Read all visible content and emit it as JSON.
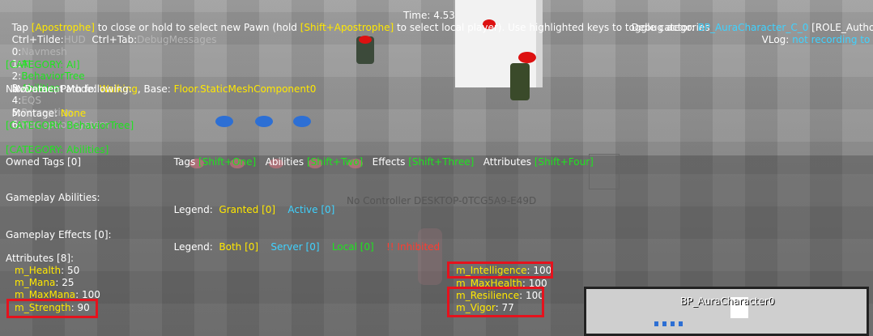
{
  "hud_top": {
    "line1_a": "Tap ",
    "line1_key1": "[Apostrophe]",
    "line1_b": " to close or hold to select new Pawn (hold ",
    "line1_key2": "[Shift+Apostrophe]",
    "line1_c": " to select local player). Use highlighted keys to toggle categories",
    "line2_a": "Ctrl+Tilde:",
    "line2_b": "HUD",
    "line2_c": "  Ctrl+Tab:",
    "line2_d": "DebugMessages",
    "time_label": "Time: 4.53",
    "debug_actor_label": "Debug actor: ",
    "debug_actor_value": "BP_AuraCharacter_C_0",
    "debug_actor_role": " [ROLE_Authority]",
    "vlog_label": "VLog: ",
    "vlog_value": "not recording to file"
  },
  "category_keys": [
    {
      "key": "0:",
      "name": "Navmesh",
      "color": "gray"
    },
    {
      "key": "1:",
      "name": "AI",
      "color": "green"
    },
    {
      "key": "2:",
      "name": "BehaviorTree",
      "color": "green"
    },
    {
      "key": "3:",
      "name": "Abilities",
      "color": "green"
    },
    {
      "key": "4:",
      "name": "EQS",
      "color": "gray"
    },
    {
      "key": "5:",
      "name": "Perception",
      "color": "gray"
    },
    {
      "key": "6:",
      "name": "PerceptionSystem",
      "color": "gray"
    }
  ],
  "ai_section": {
    "header": "[CATEGORY: AI]",
    "movement_label": "Movement Mode: ",
    "movement_value": "Walking",
    "base_label": ", Base: ",
    "base_value": "Floor.StaticMeshComponent0",
    "navdata": "NavData: , Path following:",
    "montage_label": "Montage: ",
    "montage_value": "None"
  },
  "behavior_tree": {
    "header": "[CATEGORY: BehaviorTree]"
  },
  "abilities_section": {
    "header": "[CATEGORY: Abilities]",
    "tabs": [
      {
        "label": "Tags ",
        "key": "[Shift+One]"
      },
      {
        "label": "Abilities ",
        "key": "[Shift+Two]"
      },
      {
        "label": "Effects ",
        "key": "[Shift+Three]"
      },
      {
        "label": "Attributes ",
        "key": "[Shift+Four]"
      }
    ],
    "owned_tags": "Owned Tags [0]",
    "gameplay_abilities": "Gameplay Abilities:",
    "legend_label": "Legend:",
    "granted": "Granted [0]",
    "active": "Active [0]",
    "no_controller": "No Controller DESKTOP-0TCG5A9-E49D",
    "gameplay_effects": "Gameplay Effects [0]:",
    "both": "Both [0]",
    "server": "Server [0]",
    "local": "Local [0]",
    "inhibited": "!! Inhibited"
  },
  "attributes": {
    "header": "Attributes [8]:",
    "left": [
      {
        "name": "m_Health",
        "value": ": 50"
      },
      {
        "name": "m_Mana",
        "value": ": 25"
      },
      {
        "name": "m_MaxMana",
        "value": ": 100"
      },
      {
        "name": "m_Strength",
        "value": ": 90"
      }
    ],
    "right": [
      {
        "name": "m_Intelligence",
        "value": ": 100"
      },
      {
        "name": "m_MaxHealth",
        "value": ": 100"
      },
      {
        "name": "m_Resilience",
        "value": ": 100"
      },
      {
        "name": "m_Vigor",
        "value": ": 77"
      }
    ]
  },
  "minimap": {
    "title": "BP_AuraCharacter0"
  },
  "colors": {
    "key_yellow": "#ffe800",
    "value_cyan": "#3fd2ff",
    "active_green": "#1ee51e",
    "inactive_gray": "#b5b5b5",
    "highlight_red": "#e5121d"
  }
}
